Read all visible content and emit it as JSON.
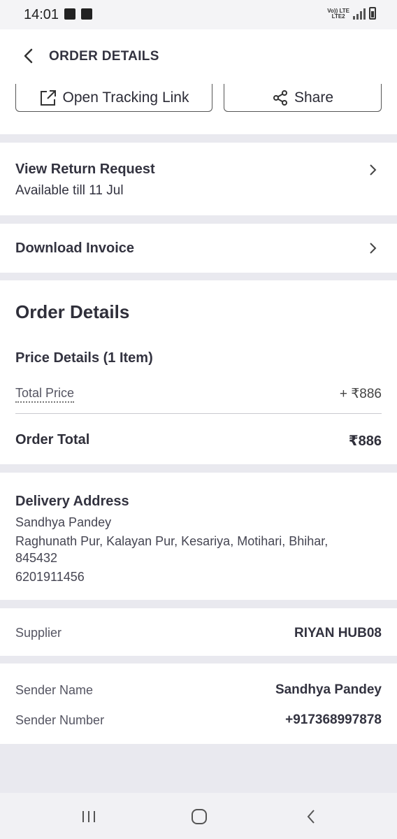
{
  "status_bar": {
    "time": "14:01",
    "net_top": "Vo)) LTE",
    "net_bottom": "LTE2"
  },
  "header": {
    "title": "ORDER DETAILS"
  },
  "tracking": {
    "open_tracking_label": "Open Tracking Link",
    "share_label": "Share"
  },
  "return_request": {
    "title": "View Return Request",
    "subtitle": "Available till 11 Jul"
  },
  "invoice": {
    "title": "Download Invoice"
  },
  "order_details": {
    "heading": "Order Details",
    "price_details_heading": "Price Details (1 Item)",
    "total_price_label": "Total Price",
    "total_price_value": "+ ₹886",
    "order_total_label": "Order Total",
    "order_total_value": "₹886"
  },
  "delivery_address": {
    "title": "Delivery Address",
    "name": "Sandhya Pandey",
    "line1": "Raghunath Pur, Kalayan Pur, Kesariya, Motihari, Bhihar,",
    "line2": "845432",
    "phone": "6201911456"
  },
  "supplier": {
    "label": "Supplier",
    "value": "RIYAN HUB08"
  },
  "sender": {
    "name_label": "Sender Name",
    "name_value": "Sandhya Pandey",
    "number_label": "Sender Number",
    "number_value": "+917368997878"
  },
  "icons": {
    "back": "back-arrow-icon",
    "open_link": "external-link-icon",
    "share": "share-icon",
    "chevron": "chevron-right-icon",
    "nav_recents": "recents-icon",
    "nav_home": "home-icon",
    "nav_back": "nav-back-icon"
  }
}
